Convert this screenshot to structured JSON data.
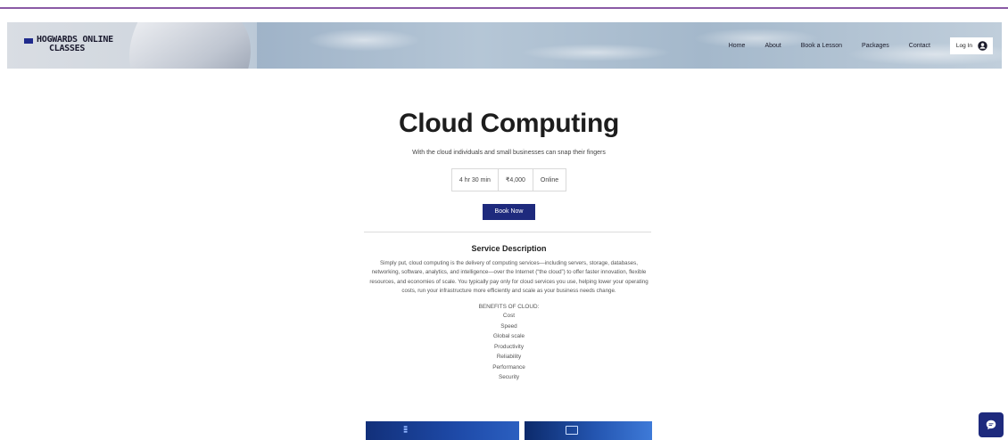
{
  "header": {
    "logo_line1": "HOGWARDS ONLINE",
    "logo_line2": "CLASSES",
    "nav": [
      "Home",
      "About",
      "Book a Lesson",
      "Packages",
      "Contact"
    ],
    "login_label": "Log In"
  },
  "service": {
    "title": "Cloud Computing",
    "subtitle": "With the cloud individuals and small businesses can snap their fingers",
    "duration": "4 hr 30 min",
    "price": "₹4,000",
    "location": "Online",
    "book_button": "Book Now",
    "section_title": "Service Description",
    "description": "Simply put, cloud computing is the delivery of computing services—including servers, storage, databases, networking, software, analytics, and intelligence—over the Internet (“the cloud”) to offer faster innovation, flexible resources, and economies of scale. You typically pay only for cloud services you use, helping lower your operating costs, run your infrastructure more efficiently and scale as your business needs change.",
    "benefits_title": "BENEFITS OF CLOUD:",
    "benefits": [
      "Cost",
      "Speed",
      "Global scale",
      "Productivity",
      "Reliability",
      "Performance",
      "Security"
    ]
  },
  "colors": {
    "accent": "#1e2a7d",
    "top_rule": "#8a5aa5"
  },
  "icons": {
    "user": "user-circle-icon",
    "chat": "chat-icon"
  }
}
